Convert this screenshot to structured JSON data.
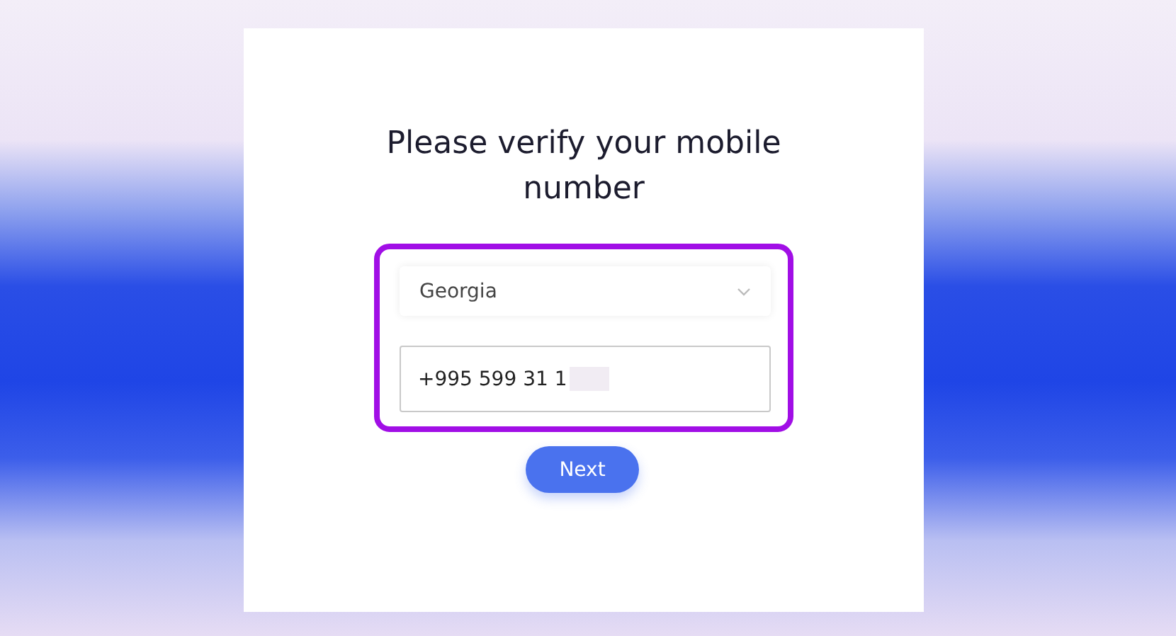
{
  "title": "Please verify your mobile number",
  "country_select": {
    "value": "Georgia"
  },
  "phone_field": {
    "value": "+995 599 31 1",
    "redacted": true
  },
  "highlight": {
    "on": true
  },
  "next_button": {
    "label": "Next"
  }
}
